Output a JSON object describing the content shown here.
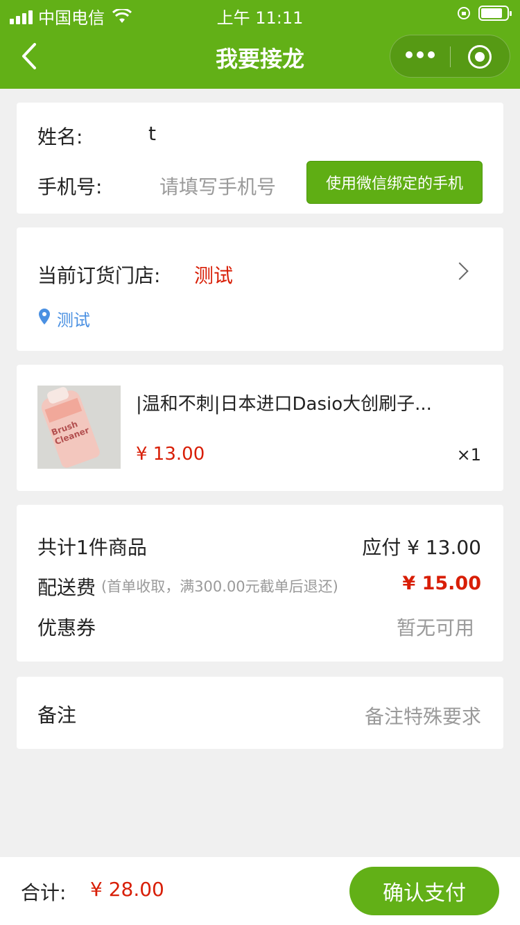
{
  "status_bar": {
    "carrier": "中国电信",
    "time": "上午 11:11"
  },
  "nav": {
    "title": "我要接龙"
  },
  "contact": {
    "name_label": "姓名:",
    "name_value": "t",
    "phone_label": "手机号:",
    "phone_placeholder": "请填写手机号",
    "wechat_phone_button": "使用微信绑定的手机"
  },
  "store": {
    "label": "当前订货门店:",
    "name": "测试",
    "address": "测试"
  },
  "product": {
    "title": "|温和不刺|日本进口Dasio大创刷子...",
    "price": "¥ 13.00",
    "quantity": "×1",
    "thumb_text": "Brush Cleaner"
  },
  "summary": {
    "total_items": "共计1件商品",
    "payable": "应付 ¥ 13.00",
    "shipping_label": "配送费",
    "shipping_note": "(首单收取，满300.00元截单后退还)",
    "shipping_fee": "¥ 15.00",
    "coupon_label": "优惠券",
    "coupon_value": "暂无可用"
  },
  "remark": {
    "label": "备注",
    "placeholder": "备注特殊要求"
  },
  "footer": {
    "total_label": "合计:",
    "total_value": "¥ 28.00",
    "confirm_button": "确认支付"
  },
  "colors": {
    "brand": "#62b017",
    "price": "#d81e06",
    "location": "#4a90e2"
  }
}
